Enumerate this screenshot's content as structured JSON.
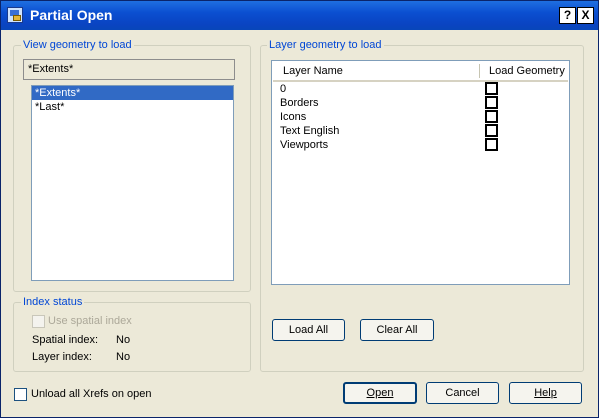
{
  "window": {
    "title": "Partial Open",
    "help_glyph": "?",
    "close_glyph": "X"
  },
  "view_group": {
    "legend": "View geometry to load",
    "current_value": "*Extents*",
    "items": [
      {
        "label": "*Extents*",
        "selected": true
      },
      {
        "label": "*Last*",
        "selected": false
      }
    ]
  },
  "layer_group": {
    "legend": "Layer geometry to load",
    "col_layer_name": "Layer Name",
    "col_load_geometry": "Load Geometry",
    "layers": [
      {
        "name": "0",
        "load": false
      },
      {
        "name": "Borders",
        "load": false
      },
      {
        "name": "Icons",
        "load": false
      },
      {
        "name": "Text English",
        "load": false
      },
      {
        "name": "Viewports",
        "load": false
      }
    ],
    "load_all_label": "Load All",
    "clear_all_label": "Clear All"
  },
  "index_group": {
    "legend": "Index status",
    "use_spatial_index_label": "Use spatial index",
    "spatial_index_label": "Spatial index:",
    "spatial_index_value": "No",
    "layer_index_label": "Layer index:",
    "layer_index_value": "No"
  },
  "unload_xrefs_label": "Unload all Xrefs on open",
  "buttons": {
    "open": "Open",
    "cancel": "Cancel",
    "help": "Help"
  }
}
